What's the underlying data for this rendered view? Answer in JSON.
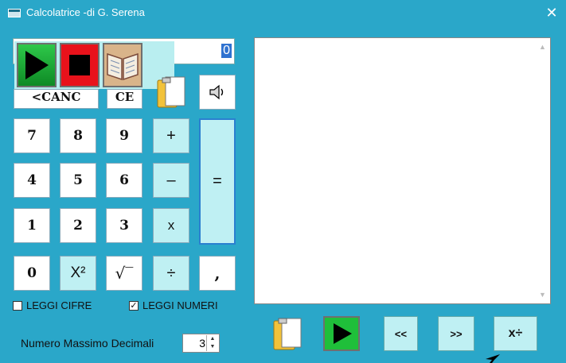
{
  "window": {
    "title": "Calcolatrice -di G. Serena",
    "close_glyph": "✕"
  },
  "display": {
    "value": "0"
  },
  "keys": {
    "backspace": "<CANC",
    "clear": "CE",
    "n7": "7",
    "n8": "8",
    "n9": "9",
    "n4": "4",
    "n5": "5",
    "n6": "6",
    "n1": "1",
    "n2": "2",
    "n3": "3",
    "n0": "0",
    "plus": "+",
    "minus": "–",
    "times": "x",
    "divide": "÷",
    "equals": "=",
    "square": "X²",
    "sqrt": "√‾",
    "comma": ","
  },
  "options": {
    "read_digits": {
      "label": "LEGGI CIFRE",
      "checked": false
    },
    "read_numbers": {
      "label": "LEGGI NUMERI",
      "checked": true
    }
  },
  "decimals": {
    "label": "Numero Massimo Decimali",
    "value": "3"
  },
  "bottom_buttons": {
    "prev": "<<",
    "next": ">>",
    "ops": "x÷"
  },
  "icons": {
    "play": "play-icon",
    "stop": "stop-icon",
    "book": "book-icon",
    "clipboard": "clipboard-icon",
    "speaker": "speaker-icon"
  },
  "colors": {
    "titlebar": "#2aa7c9",
    "key_face": "#ffffff",
    "op_face": "#bff0f3",
    "play_green": "#1fbf3a",
    "stop_red": "#e8121b"
  }
}
